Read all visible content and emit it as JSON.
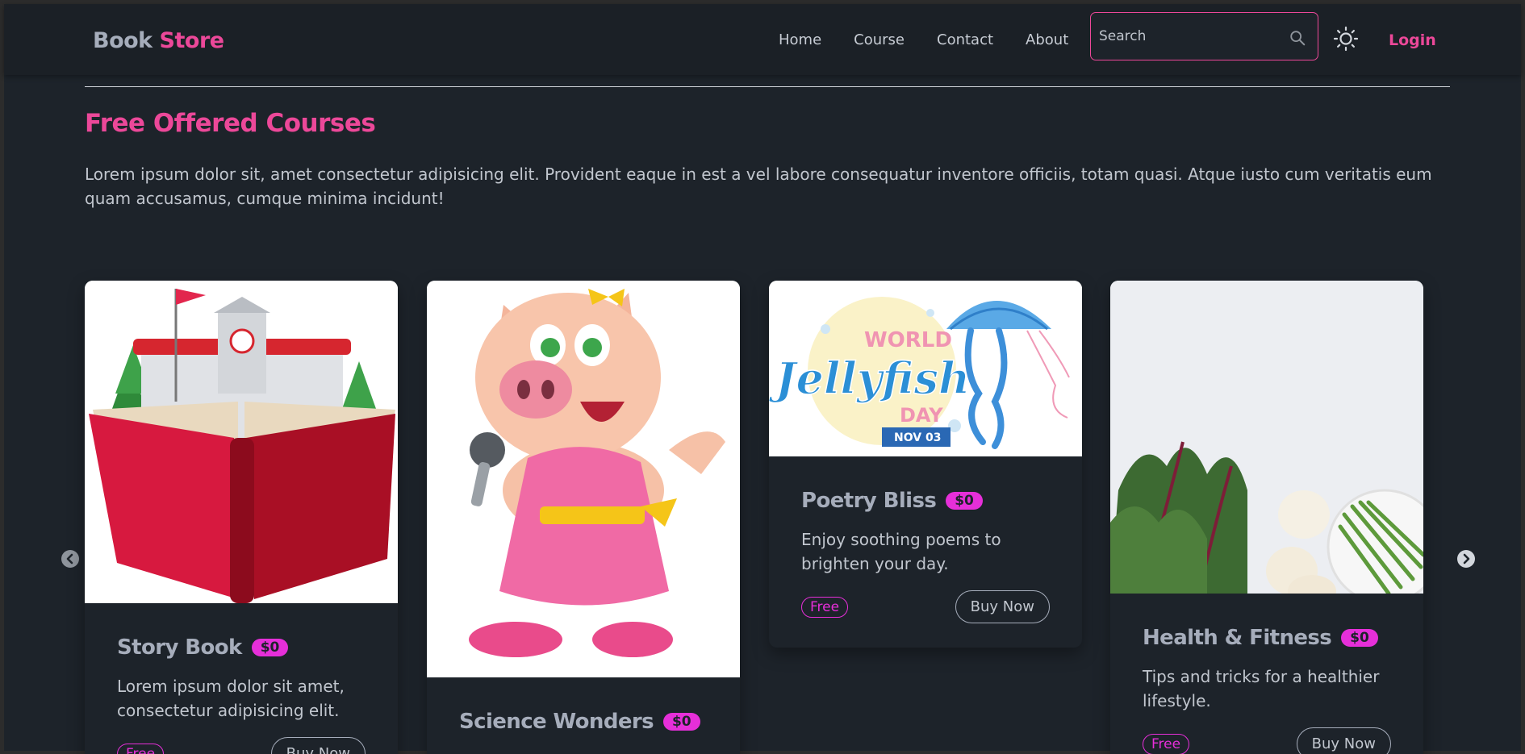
{
  "nav": {
    "brand_part1": "Book",
    "brand_part2": "Store",
    "links": [
      "Home",
      "Course",
      "Contact",
      "About"
    ],
    "search_placeholder": "Search",
    "login_label": "Login"
  },
  "section": {
    "title": "Free Offered Courses",
    "description": "Lorem ipsum dolor sit, amet consectetur adipisicing elit. Provident eaque in est a vel labore consequatur inventore officiis, totam quasi. Atque iusto cum veritatis eum quam accusamus, cumque minima incidunt!"
  },
  "cards": [
    {
      "title": "Story Book",
      "price": "$0",
      "text": "Lorem ipsum dolor sit amet, consectetur adipisicing elit.",
      "tag": "Free",
      "button": "Buy Now"
    },
    {
      "title": "Science Wonders",
      "price": "$0",
      "text": "",
      "tag": "",
      "button": ""
    },
    {
      "title": "Poetry Bliss",
      "price": "$0",
      "text": "Enjoy soothing poems to brighten your day.",
      "tag": "Free",
      "button": "Buy Now"
    },
    {
      "title": "Health & Fitness",
      "price": "$0",
      "text": "Tips and tricks for a healthier lifestyle.",
      "tag": "Free",
      "button": "Buy Now"
    }
  ],
  "banner_text": {
    "line1": "WORLD",
    "line2": "Jellyfish",
    "line3": "DAY",
    "line4": "NOV 03"
  },
  "colors": {
    "accent": "#ec4899",
    "badge": "#e62fd9",
    "background": "#1d232a",
    "navbar": "#1b2026"
  },
  "icons": {
    "search": "search-icon",
    "theme": "sun-icon",
    "prev": "chevron-left-icon",
    "next": "chevron-right-icon"
  }
}
